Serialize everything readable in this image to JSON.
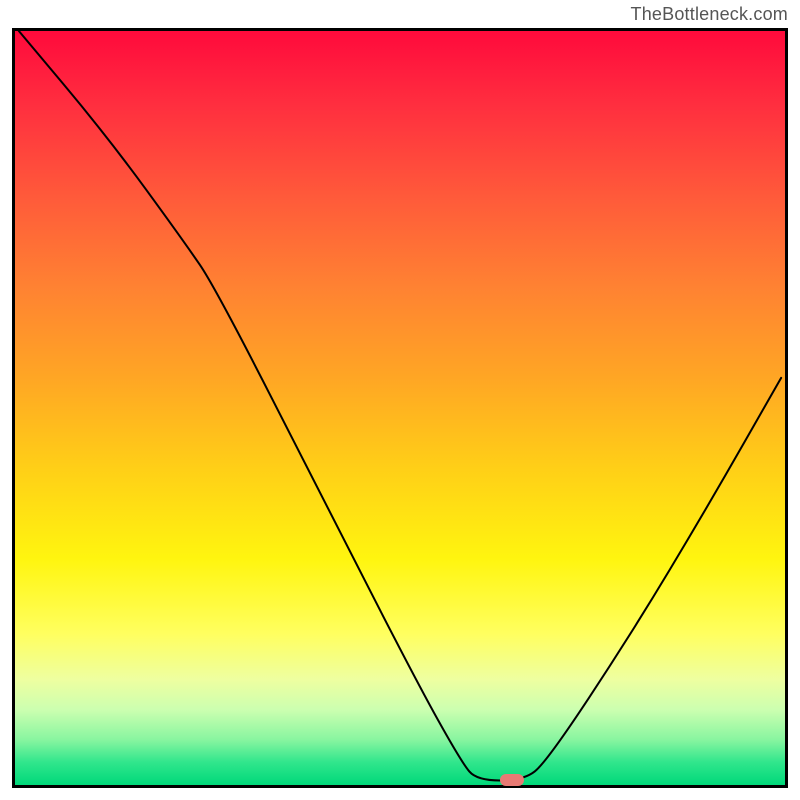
{
  "attribution": "TheBottleneck.com",
  "chart_data": {
    "type": "line",
    "title": "",
    "xlabel": "",
    "ylabel": "",
    "xlim": [
      0,
      100
    ],
    "ylim": [
      0,
      100
    ],
    "grid": false,
    "curve_points": [
      {
        "x": 0.5,
        "y": 100
      },
      {
        "x": 12,
        "y": 86
      },
      {
        "x": 22,
        "y": 72
      },
      {
        "x": 26,
        "y": 66
      },
      {
        "x": 40,
        "y": 38
      },
      {
        "x": 52,
        "y": 14
      },
      {
        "x": 58,
        "y": 3
      },
      {
        "x": 60,
        "y": 0.6
      },
      {
        "x": 66,
        "y": 0.6
      },
      {
        "x": 69,
        "y": 3
      },
      {
        "x": 80,
        "y": 20
      },
      {
        "x": 90,
        "y": 37
      },
      {
        "x": 99.5,
        "y": 54
      }
    ],
    "optimal_marker": {
      "x": 64.5,
      "y": 0.7
    },
    "gradient_stops": [
      {
        "pos": 0,
        "color": "#ff0a3c"
      },
      {
        "pos": 10,
        "color": "#ff2f3f"
      },
      {
        "pos": 22,
        "color": "#ff5a3a"
      },
      {
        "pos": 34,
        "color": "#ff8232"
      },
      {
        "pos": 46,
        "color": "#ffa624"
      },
      {
        "pos": 58,
        "color": "#ffcf17"
      },
      {
        "pos": 70,
        "color": "#fff50f"
      },
      {
        "pos": 80,
        "color": "#ffff60"
      },
      {
        "pos": 86,
        "color": "#eeffa0"
      },
      {
        "pos": 90,
        "color": "#ccffb0"
      },
      {
        "pos": 94,
        "color": "#88f5a0"
      },
      {
        "pos": 97,
        "color": "#30e68c"
      },
      {
        "pos": 100,
        "color": "#00d87a"
      }
    ]
  }
}
